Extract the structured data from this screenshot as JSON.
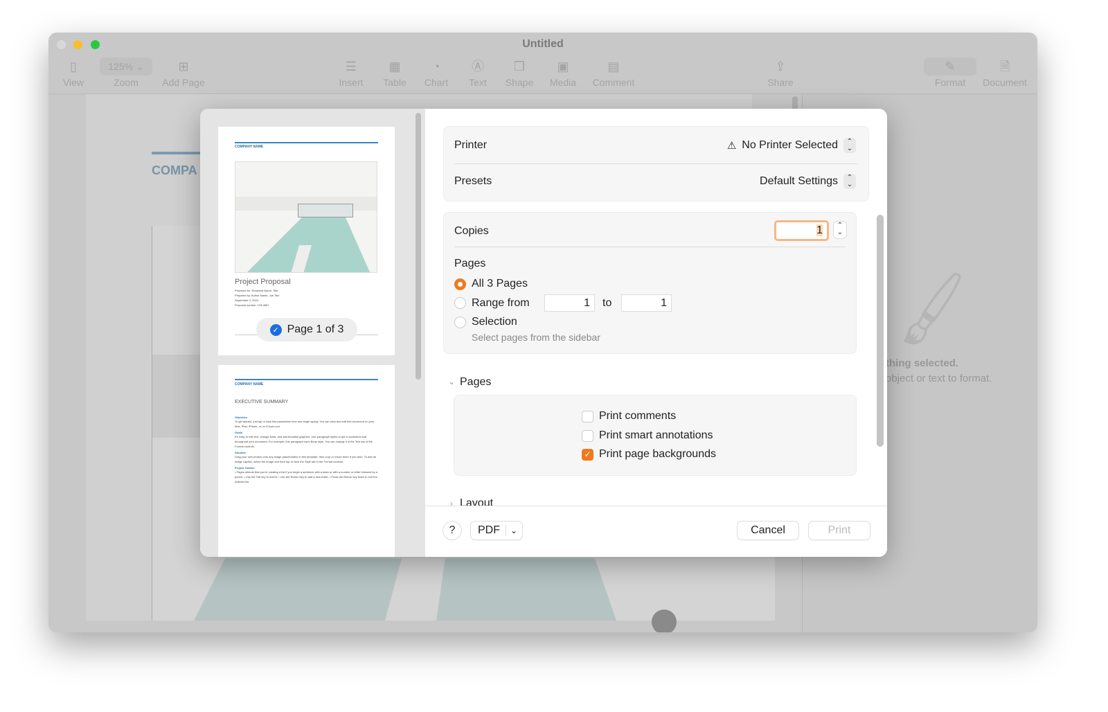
{
  "window": {
    "title": "Untitled"
  },
  "toolbar": {
    "zoom_value": "125%",
    "items": [
      {
        "label": "View",
        "icon": "sidebar-icon"
      },
      {
        "label": "Zoom",
        "icon": "chevron-down-icon"
      },
      {
        "label": "Add Page",
        "icon": "add-page-icon"
      },
      {
        "label": "Insert",
        "icon": "insert-icon"
      },
      {
        "label": "Table",
        "icon": "table-icon"
      },
      {
        "label": "Chart",
        "icon": "chart-icon"
      },
      {
        "label": "Text",
        "icon": "text-icon"
      },
      {
        "label": "Shape",
        "icon": "shape-icon"
      },
      {
        "label": "Media",
        "icon": "media-icon"
      },
      {
        "label": "Comment",
        "icon": "comment-icon"
      },
      {
        "label": "Share",
        "icon": "share-icon"
      },
      {
        "label": "Format",
        "icon": "paintbrush-icon"
      },
      {
        "label": "Document",
        "icon": "document-icon"
      }
    ]
  },
  "document": {
    "company_heading": "COMPA"
  },
  "inspector": {
    "line1": "thing selected.",
    "line2": "object or text to format."
  },
  "print_dialog": {
    "thumbnails": [
      {
        "company": "COMPANY NAME",
        "title": "Project Proposal",
        "lines": [
          "Prepared for: Recipient Name, Title",
          "Prepared by: Author Name, Job Title",
          "September 3, 2024",
          "Proposal number: 123-4567"
        ],
        "badge": "Page 1 of 3",
        "selected": true
      },
      {
        "company": "COMPANY NAME",
        "title": "EXECUTIVE SUMMARY",
        "sections": [
          {
            "heading": "Objective",
            "text": "To get started, just tap or click this placeholder text and begin typing. You can view and edit this document on your Mac, iPad, iPhone, or on iCloud.com."
          },
          {
            "heading": "Goals",
            "text": "It's easy to edit text, change fonts, and add beautiful graphics. Use paragraph styles to get a consistent look throughout your document. For example, this paragraph uses Body style. You can change it in the Text tab of the Format controls."
          },
          {
            "heading": "Solution",
            "text": "Drag your own photos onto any image placeholders in this template, then crop or resize them if you wish. To add an image caption, select the image and then tap or click the Style tab in the Format controls."
          },
          {
            "heading": "Project Outline",
            "text": "• Pages detects that you're creating a list if you begin a sentence with a dash or with a number or letter followed by a period. • Use the Tab key to indent. • Use the Return key to add a new bullet. • Press the Return key twice to end the bulleted list."
          }
        ]
      }
    ],
    "printer_label": "Printer",
    "printer_value": "No Printer Selected",
    "presets_label": "Presets",
    "presets_value": "Default Settings",
    "copies_label": "Copies",
    "copies_value": "1",
    "pages_label": "Pages",
    "pages_options": {
      "all": "All 3 Pages",
      "range": "Range from",
      "to": "to",
      "selection": "Selection",
      "selection_hint": "Select pages from the sidebar"
    },
    "range_from": "1",
    "range_to": "1",
    "pages_selected": "all",
    "pages_section": "Pages",
    "checkboxes": [
      {
        "label": "Print comments",
        "checked": false
      },
      {
        "label": "Print smart annotations",
        "checked": false
      },
      {
        "label": "Print page backgrounds",
        "checked": true
      }
    ],
    "layout_section": "Layout",
    "help": "?",
    "pdf": "PDF",
    "cancel": "Cancel",
    "print": "Print",
    "accent_color": "#f07a1e"
  }
}
